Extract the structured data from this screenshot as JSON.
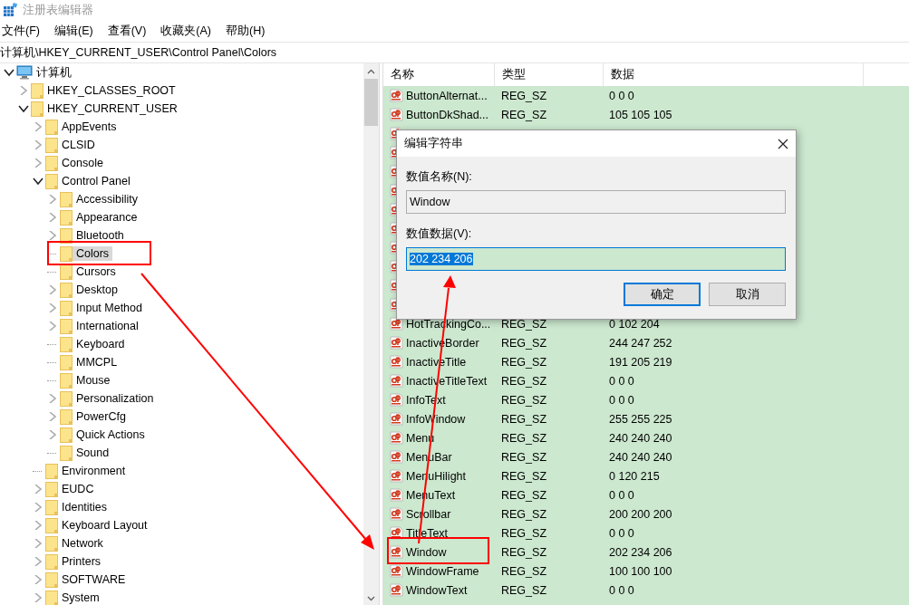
{
  "window": {
    "title": "注册表编辑器"
  },
  "menu": [
    "文件(F)",
    "编辑(E)",
    "查看(V)",
    "收藏夹(A)",
    "帮助(H)"
  ],
  "address": "计算机\\HKEY_CURRENT_USER\\Control Panel\\Colors",
  "tree": [
    {
      "label": "计算机",
      "kind": "computer",
      "expanded": true,
      "selected": false,
      "children": [
        {
          "label": "HKEY_CLASSES_ROOT",
          "kind": "branch",
          "expanded": false,
          "selected": false
        },
        {
          "label": "HKEY_CURRENT_USER",
          "kind": "branch",
          "expanded": true,
          "selected": false,
          "children": [
            {
              "label": "AppEvents",
              "kind": "branch",
              "expanded": false,
              "selected": false
            },
            {
              "label": "CLSID",
              "kind": "branch",
              "expanded": false,
              "selected": false
            },
            {
              "label": "Console",
              "kind": "branch",
              "expanded": false,
              "selected": false
            },
            {
              "label": "Control Panel",
              "kind": "branch",
              "expanded": true,
              "selected": false,
              "children": [
                {
                  "label": "Accessibility",
                  "kind": "branch",
                  "expanded": false,
                  "selected": false
                },
                {
                  "label": "Appearance",
                  "kind": "branch",
                  "expanded": false,
                  "selected": false
                },
                {
                  "label": "Bluetooth",
                  "kind": "branch",
                  "expanded": false,
                  "selected": false
                },
                {
                  "label": "Colors",
                  "kind": "leaf",
                  "selected": true
                },
                {
                  "label": "Cursors",
                  "kind": "leaf",
                  "selected": false
                },
                {
                  "label": "Desktop",
                  "kind": "branch",
                  "expanded": false,
                  "selected": false
                },
                {
                  "label": "Input Method",
                  "kind": "branch",
                  "expanded": false,
                  "selected": false
                },
                {
                  "label": "International",
                  "kind": "branch",
                  "expanded": false,
                  "selected": false
                },
                {
                  "label": "Keyboard",
                  "kind": "leaf",
                  "selected": false
                },
                {
                  "label": "MMCPL",
                  "kind": "leaf",
                  "selected": false
                },
                {
                  "label": "Mouse",
                  "kind": "leaf",
                  "selected": false
                },
                {
                  "label": "Personalization",
                  "kind": "branch",
                  "expanded": false,
                  "selected": false
                },
                {
                  "label": "PowerCfg",
                  "kind": "branch",
                  "expanded": false,
                  "selected": false
                },
                {
                  "label": "Quick Actions",
                  "kind": "branch",
                  "expanded": false,
                  "selected": false
                },
                {
                  "label": "Sound",
                  "kind": "leaf",
                  "selected": false
                }
              ]
            },
            {
              "label": "Environment",
              "kind": "leaf",
              "selected": false
            },
            {
              "label": "EUDC",
              "kind": "branch",
              "expanded": false,
              "selected": false
            },
            {
              "label": "Identities",
              "kind": "branch",
              "expanded": false,
              "selected": false
            },
            {
              "label": "Keyboard Layout",
              "kind": "branch",
              "expanded": false,
              "selected": false
            },
            {
              "label": "Network",
              "kind": "branch",
              "expanded": false,
              "selected": false
            },
            {
              "label": "Printers",
              "kind": "branch",
              "expanded": false,
              "selected": false
            },
            {
              "label": "SOFTWARE",
              "kind": "branch",
              "expanded": false,
              "selected": false
            },
            {
              "label": "System",
              "kind": "branch",
              "expanded": false,
              "selected": false
            }
          ]
        }
      ]
    }
  ],
  "list": {
    "columns": [
      "名称",
      "类型",
      "数据"
    ],
    "rows": [
      {
        "kind": "value",
        "name": "ButtonAlternat...",
        "type": "REG_SZ",
        "data": "0 0 0"
      },
      {
        "kind": "value",
        "name": "ButtonDkShad...",
        "type": "REG_SZ",
        "data": "105 105 105"
      },
      {
        "kind": "covered"
      },
      {
        "kind": "covered"
      },
      {
        "kind": "covered"
      },
      {
        "kind": "covered"
      },
      {
        "kind": "covered"
      },
      {
        "kind": "covered"
      },
      {
        "kind": "covered"
      },
      {
        "kind": "covered"
      },
      {
        "kind": "covered"
      },
      {
        "kind": "covered"
      },
      {
        "kind": "value",
        "name": "HotTrackingCo...",
        "type": "REG_SZ",
        "data": "0 102 204"
      },
      {
        "kind": "value",
        "name": "InactiveBorder",
        "type": "REG_SZ",
        "data": "244 247 252"
      },
      {
        "kind": "value",
        "name": "InactiveTitle",
        "type": "REG_SZ",
        "data": "191 205 219"
      },
      {
        "kind": "value",
        "name": "InactiveTitleText",
        "type": "REG_SZ",
        "data": "0 0 0"
      },
      {
        "kind": "value",
        "name": "InfoText",
        "type": "REG_SZ",
        "data": "0 0 0"
      },
      {
        "kind": "value",
        "name": "InfoWindow",
        "type": "REG_SZ",
        "data": "255 255 225"
      },
      {
        "kind": "value",
        "name": "Menu",
        "type": "REG_SZ",
        "data": "240 240 240"
      },
      {
        "kind": "value",
        "name": "MenuBar",
        "type": "REG_SZ",
        "data": "240 240 240"
      },
      {
        "kind": "value",
        "name": "MenuHilight",
        "type": "REG_SZ",
        "data": "0 120 215"
      },
      {
        "kind": "value",
        "name": "MenuText",
        "type": "REG_SZ",
        "data": "0 0 0"
      },
      {
        "kind": "value",
        "name": "Scrollbar",
        "type": "REG_SZ",
        "data": "200 200 200"
      },
      {
        "kind": "value",
        "name": "TitleText",
        "type": "REG_SZ",
        "data": "0 0 0"
      },
      {
        "kind": "value",
        "name": "Window",
        "type": "REG_SZ",
        "data": "202 234 206"
      },
      {
        "kind": "value",
        "name": "WindowFrame",
        "type": "REG_SZ",
        "data": "100 100 100"
      },
      {
        "kind": "value",
        "name": "WindowText",
        "type": "REG_SZ",
        "data": "0 0 0"
      }
    ]
  },
  "dialog": {
    "title": "编辑字符串",
    "name_label": "数值名称(N):",
    "name_value": "Window",
    "data_label": "数值数据(V):",
    "data_value": "202 234 206",
    "buttons": [
      {
        "label": "确定",
        "default": true
      },
      {
        "label": "取消",
        "default": false
      }
    ]
  }
}
